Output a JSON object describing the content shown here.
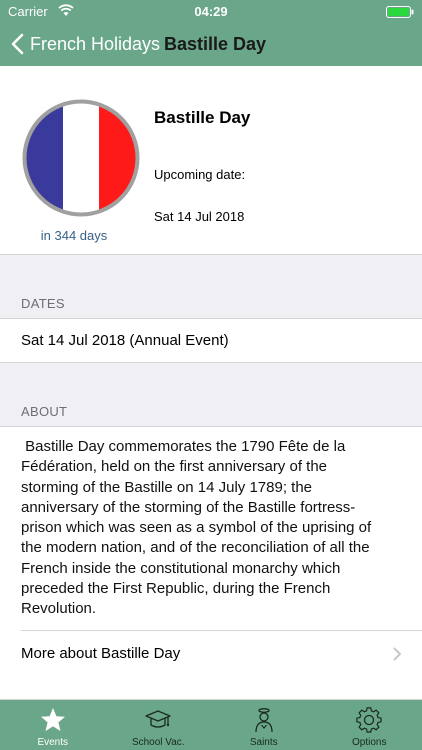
{
  "status_bar": {
    "carrier": "Carrier",
    "time": "04:29"
  },
  "nav": {
    "back_label": "French Holidays",
    "title": "Bastille Day"
  },
  "header": {
    "event_name": "Bastille Day",
    "countdown": "in 344 days",
    "upcoming_label": "Upcoming date:",
    "upcoming_date": "Sat 14 Jul 2018",
    "flag_colors": [
      "#3a3a9c",
      "#ffffff",
      "#ff1a1a"
    ]
  },
  "sections": {
    "dates": {
      "heading": "DATES",
      "value": "Sat 14 Jul 2018 (Annual Event)"
    },
    "about": {
      "heading": "ABOUT",
      "lines": [
        " Bastille Day commemorates the 1790 Fête de la",
        "Fédération, held on the first anniversary of the",
        "storming of the Bastille on 14 July 1789; the",
        "anniversary of the storming of the Bastille fortress-",
        "prison which was seen as a symbol of the uprising of",
        "the modern nation, and of the reconciliation of all the",
        "French inside the constitutional monarchy which",
        "preceded the First Republic, during the French",
        "Revolution."
      ],
      "more_label": "More about Bastille Day"
    }
  },
  "tabs": [
    {
      "label": "Events",
      "icon": "star-icon",
      "active": true
    },
    {
      "label": "School Vac.",
      "icon": "graduation-cap-icon",
      "active": false
    },
    {
      "label": "Saints",
      "icon": "saint-icon",
      "active": false
    },
    {
      "label": "Options",
      "icon": "gear-icon",
      "active": false
    }
  ],
  "colors": {
    "accent": "#6aa68a",
    "link": "#36628a"
  }
}
